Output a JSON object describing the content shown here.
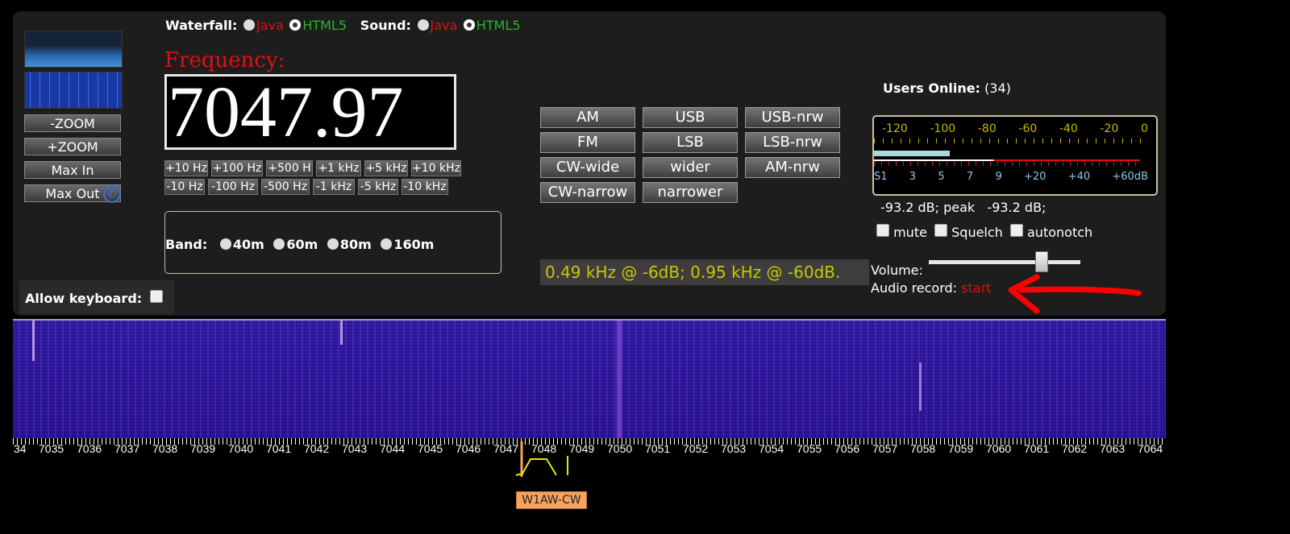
{
  "waterfall_label": "Waterfall:",
  "sound_label": "Sound:",
  "opt_java": "Java",
  "opt_html5": "HTML5",
  "zoom_out": "-ZOOM",
  "zoom_in": "+ZOOM",
  "max_in": "Max In",
  "max_out": "Max Out",
  "frequency_label": "Frequency:",
  "frequency": "7047.97",
  "steps_up": [
    "+10 Hz",
    "+100 Hz",
    "+500 H",
    "+1 kHz",
    "+5 kHz",
    "+10 kHz"
  ],
  "steps_down": [
    "-10 Hz",
    "-100 Hz",
    "-500 Hz",
    "-1 kHz",
    "-5 kHz",
    "-10 kHz"
  ],
  "band_label": "Band:",
  "bands": [
    "40m",
    "60m",
    "80m",
    "160m"
  ],
  "modes": [
    [
      "AM",
      "USB",
      "USB-nrw"
    ],
    [
      "FM",
      "LSB",
      "LSB-nrw"
    ],
    [
      "CW-wide",
      "wider",
      "AM-nrw"
    ],
    [
      "CW-narrow",
      "narrower"
    ]
  ],
  "filter_info": "0.49 kHz @ -6dB; 0.95 kHz @ -60dB.",
  "users_label": "Users Online:",
  "users_count": "(34)",
  "smeter_top": [
    "-120",
    "-100",
    "-80",
    "-60",
    "-40",
    "-20",
    "0"
  ],
  "smeter_bottom": [
    "S1",
    "3",
    "5",
    "7",
    "9",
    "+20",
    "+40",
    "+60dB"
  ],
  "signal_text": "-93.2 dB; peak   -93.2 dB;",
  "mute": "mute",
  "squelch": "Squelch",
  "autonotch": "autonotch",
  "volume_label": "Volume:",
  "audio_record_label": "Audio record:",
  "audio_record_start": "start",
  "allow_keyboard": "Allow keyboard:",
  "scale_labels": [
    "34",
    "7035",
    "7036",
    "7037",
    "7038",
    "7039",
    "7040",
    "7041",
    "7042",
    "7043",
    "7044",
    "7045",
    "7046",
    "7047",
    "7048",
    "7049",
    "7050",
    "7051",
    "7052",
    "7053",
    "7054",
    "7055",
    "7056",
    "7057",
    "7058",
    "7059",
    "7060",
    "7061",
    "7062",
    "7063",
    "7064"
  ],
  "spot_label": "W1AW-CW",
  "colors": {
    "accent_red": "#e01010",
    "green": "#30b030",
    "filter_text": "#c8c800",
    "spot_bg": "#f4a460"
  }
}
